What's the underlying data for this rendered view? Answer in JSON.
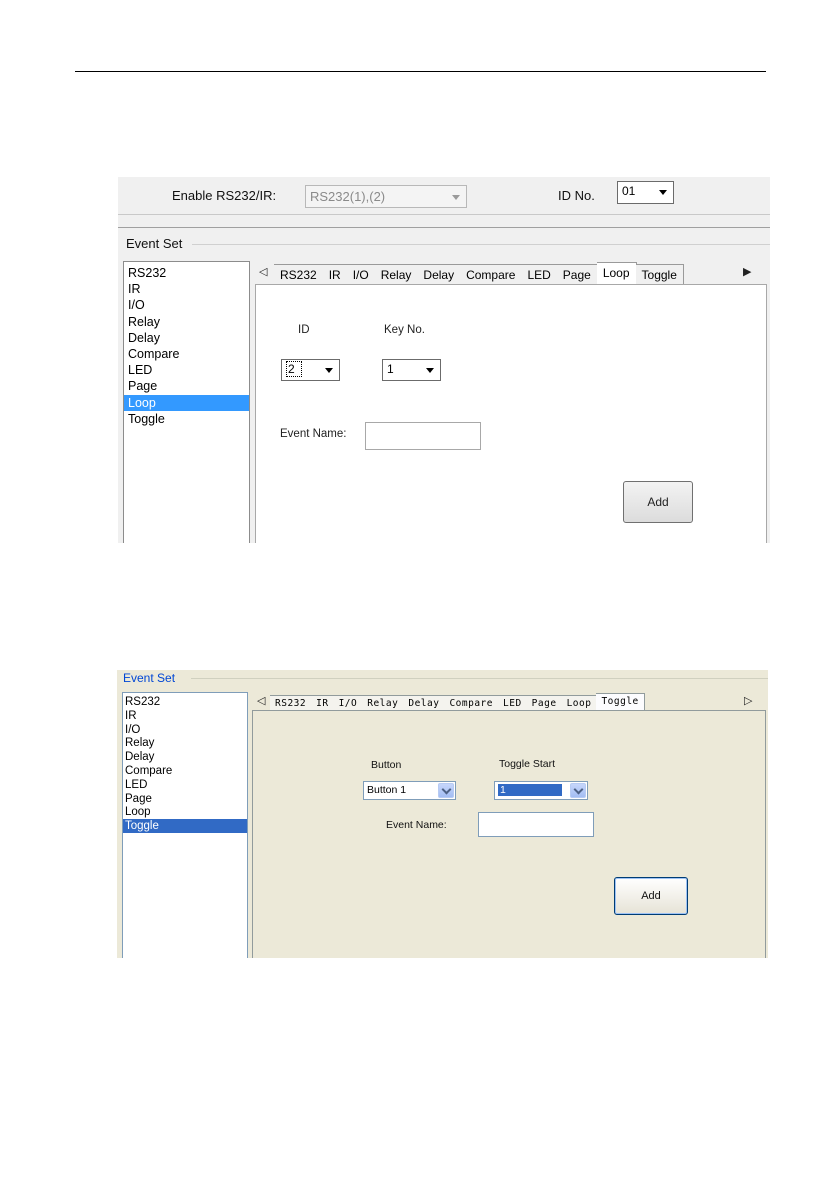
{
  "shot1": {
    "enable_label": "Enable RS232/IR:",
    "enable_value": "RS232(1),(2)",
    "id_no_label": "ID No.",
    "id_no_value": "01",
    "group_title": "Event Set",
    "list_items": [
      "RS232",
      "IR",
      "I/O",
      "Relay",
      "Delay",
      "Compare",
      "LED",
      "Page",
      "Loop",
      "Toggle"
    ],
    "selected_item": "Loop",
    "tabs": [
      "RS232",
      "IR",
      "I/O",
      "Relay",
      "Delay",
      "Compare",
      "LED",
      "Page",
      "Loop",
      "Toggle"
    ],
    "active_tab": "Loop",
    "id_label": "ID",
    "id_value": "2",
    "key_label": "Key No.",
    "key_value": "1",
    "event_name_label": "Event Name:",
    "event_name_value": "",
    "add_label": "Add"
  },
  "shot2": {
    "group_title": "Event Set",
    "list_items": [
      "RS232",
      "IR",
      "I/O",
      "Relay",
      "Delay",
      "Compare",
      "LED",
      "Page",
      "Loop",
      "Toggle"
    ],
    "selected_item": "Toggle",
    "tabs": [
      "RS232",
      "IR",
      "I/O",
      "Relay",
      "Delay",
      "Compare",
      "LED",
      "Page",
      "Loop",
      "Toggle"
    ],
    "active_tab": "Toggle",
    "button_label": "Button",
    "button_value": "Button 1",
    "toggle_start_label": "Toggle Start",
    "toggle_start_value": "1",
    "event_name_label": "Event Name:",
    "event_name_value": "",
    "add_label": "Add"
  }
}
